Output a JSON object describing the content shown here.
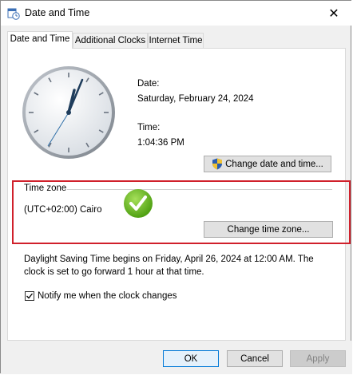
{
  "window": {
    "title": "Date and Time",
    "close_glyph": "✕"
  },
  "tabs": [
    {
      "label": "Date and Time"
    },
    {
      "label": "Additional Clocks"
    },
    {
      "label": "Internet Time"
    }
  ],
  "date": {
    "label": "Date:",
    "value": "Saturday, February 24, 2024"
  },
  "time": {
    "label": "Time:",
    "value": "1:04:36 PM"
  },
  "change_datetime_label": "Change date and time...",
  "timezone": {
    "group_label": "Time zone",
    "value": "(UTC+02:00) Cairo",
    "change_label": "Change time zone..."
  },
  "dst_note": {
    "line1": "Daylight Saving Time begins on Friday, April 26, 2024 at 12:00 AM. The",
    "line2": "clock is set to go forward 1 hour at that time."
  },
  "notify": {
    "label": "Notify me when the clock changes",
    "checked": true
  },
  "footer": {
    "ok": "OK",
    "cancel": "Cancel",
    "apply": "Apply"
  },
  "colors": {
    "highlight": "#d0202b",
    "check_green": "#6cc020"
  }
}
